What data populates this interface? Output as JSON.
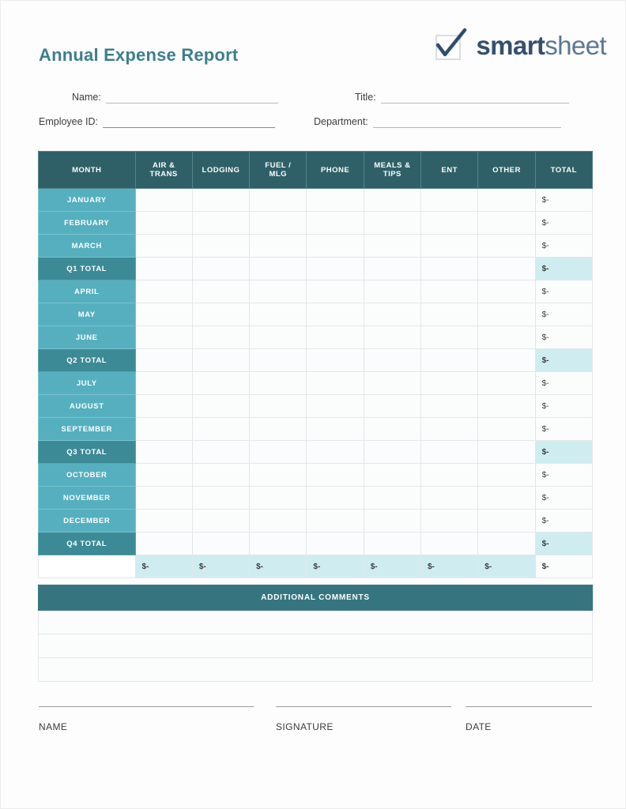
{
  "document": {
    "title": "Annual Expense Report"
  },
  "brand": {
    "logo_icon": "checkmark-box-icon",
    "name_bold": "smart",
    "name_light": "sheet"
  },
  "form": {
    "fields": [
      {
        "label": "Name:",
        "value": ""
      },
      {
        "label": "Title:",
        "value": ""
      },
      {
        "label": "Employee ID:",
        "value": ""
      },
      {
        "label": "Department:",
        "value": ""
      }
    ]
  },
  "expense_table": {
    "columns": [
      "MONTH",
      "AIR & TRANS",
      "LODGING",
      "FUEL / MLG",
      "PHONE",
      "MEALS & TIPS",
      "ENT",
      "OTHER",
      "TOTAL"
    ],
    "column_lines": [
      [
        "MONTH"
      ],
      [
        "AIR &",
        "TRANS"
      ],
      [
        "LODGING"
      ],
      [
        "FUEL /",
        "MLG"
      ],
      [
        "PHONE"
      ],
      [
        "MEALS &",
        "TIPS"
      ],
      [
        "ENT"
      ],
      [
        "OTHER"
      ],
      [
        "TOTAL"
      ]
    ],
    "empty_cell": "",
    "zero_value": "$-",
    "rows": [
      {
        "label": "JANUARY",
        "type": "month",
        "values": [
          "",
          "",
          "",
          "",
          "",
          "",
          ""
        ],
        "total": "$-"
      },
      {
        "label": "FEBRUARY",
        "type": "month",
        "values": [
          "",
          "",
          "",
          "",
          "",
          "",
          ""
        ],
        "total": "$-"
      },
      {
        "label": "MARCH",
        "type": "month",
        "values": [
          "",
          "",
          "",
          "",
          "",
          "",
          ""
        ],
        "total": "$-"
      },
      {
        "label": "Q1 TOTAL",
        "type": "quarter",
        "values": [
          "",
          "",
          "",
          "",
          "",
          "",
          ""
        ],
        "total": "$-"
      },
      {
        "label": "APRIL",
        "type": "month",
        "values": [
          "",
          "",
          "",
          "",
          "",
          "",
          ""
        ],
        "total": "$-"
      },
      {
        "label": "MAY",
        "type": "month",
        "values": [
          "",
          "",
          "",
          "",
          "",
          "",
          ""
        ],
        "total": "$-"
      },
      {
        "label": "JUNE",
        "type": "month",
        "values": [
          "",
          "",
          "",
          "",
          "",
          "",
          ""
        ],
        "total": "$-"
      },
      {
        "label": "Q2 TOTAL",
        "type": "quarter",
        "values": [
          "",
          "",
          "",
          "",
          "",
          "",
          ""
        ],
        "total": "$-"
      },
      {
        "label": "JULY",
        "type": "month",
        "values": [
          "",
          "",
          "",
          "",
          "",
          "",
          ""
        ],
        "total": "$-"
      },
      {
        "label": "AUGUST",
        "type": "month",
        "values": [
          "",
          "",
          "",
          "",
          "",
          "",
          ""
        ],
        "total": "$-"
      },
      {
        "label": "SEPTEMBER",
        "type": "month",
        "values": [
          "",
          "",
          "",
          "",
          "",
          "",
          ""
        ],
        "total": "$-"
      },
      {
        "label": "Q3 TOTAL",
        "type": "quarter",
        "values": [
          "",
          "",
          "",
          "",
          "",
          "",
          ""
        ],
        "total": "$-"
      },
      {
        "label": "OCTOBER",
        "type": "month",
        "values": [
          "",
          "",
          "",
          "",
          "",
          "",
          ""
        ],
        "total": "$-"
      },
      {
        "label": "NOVEMBER",
        "type": "month",
        "values": [
          "",
          "",
          "",
          "",
          "",
          "",
          ""
        ],
        "total": "$-"
      },
      {
        "label": "DECEMBER",
        "type": "month",
        "values": [
          "",
          "",
          "",
          "",
          "",
          "",
          ""
        ],
        "total": "$-"
      },
      {
        "label": "Q4 TOTAL",
        "type": "quarter",
        "values": [
          "",
          "",
          "",
          "",
          "",
          "",
          ""
        ],
        "total": "$-"
      },
      {
        "label": "",
        "type": "grand",
        "values": [
          "$-",
          "$-",
          "$-",
          "$-",
          "$-",
          "$-",
          "$-"
        ],
        "total": "$-"
      }
    ]
  },
  "comments": {
    "header": "ADDITIONAL COMMENTS",
    "lines": [
      "",
      "",
      ""
    ]
  },
  "signatures": [
    {
      "caption": "NAME"
    },
    {
      "caption": "SIGNATURE"
    },
    {
      "caption": "DATE"
    }
  ],
  "colors": {
    "title_teal": "#3c7f8c",
    "header_teal": "#2f6068",
    "month_teal": "#55afbe",
    "quarter_teal": "#3c8a96",
    "total_cyan": "#cfedf1",
    "comments_teal": "#36757f",
    "logo_dark": "#34506e",
    "logo_light": "#5b7794"
  }
}
